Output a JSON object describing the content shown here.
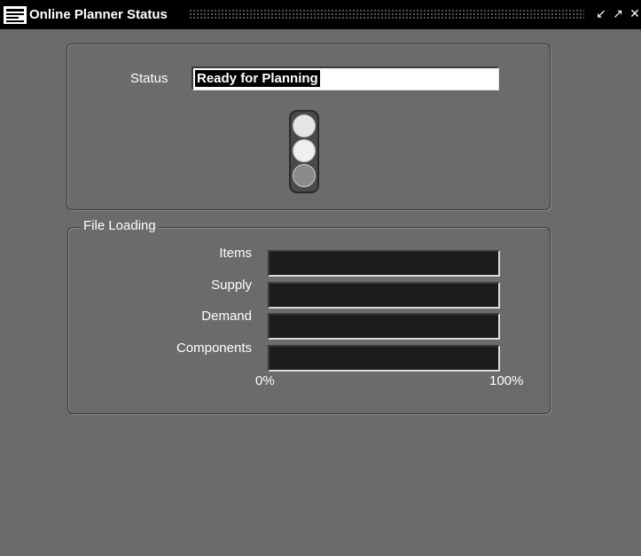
{
  "window": {
    "title": "Online Planner Status",
    "buttons": {
      "minimize_icon": "minimize-icon",
      "maximize_icon": "maximize-icon",
      "close_icon": "close-icon"
    }
  },
  "status": {
    "label": "Status",
    "value": "Ready for Planning",
    "traffic_light": {
      "top": "lit",
      "middle": "lit",
      "bottom": "dim"
    }
  },
  "file_loading": {
    "legend": "File Loading",
    "rows": [
      {
        "label": "Items",
        "progress_percent": 0
      },
      {
        "label": "Supply",
        "progress_percent": 0
      },
      {
        "label": "Demand",
        "progress_percent": 0
      },
      {
        "label": "Components",
        "progress_percent": 0
      }
    ],
    "scale_min": "0%",
    "scale_max": "100%"
  }
}
